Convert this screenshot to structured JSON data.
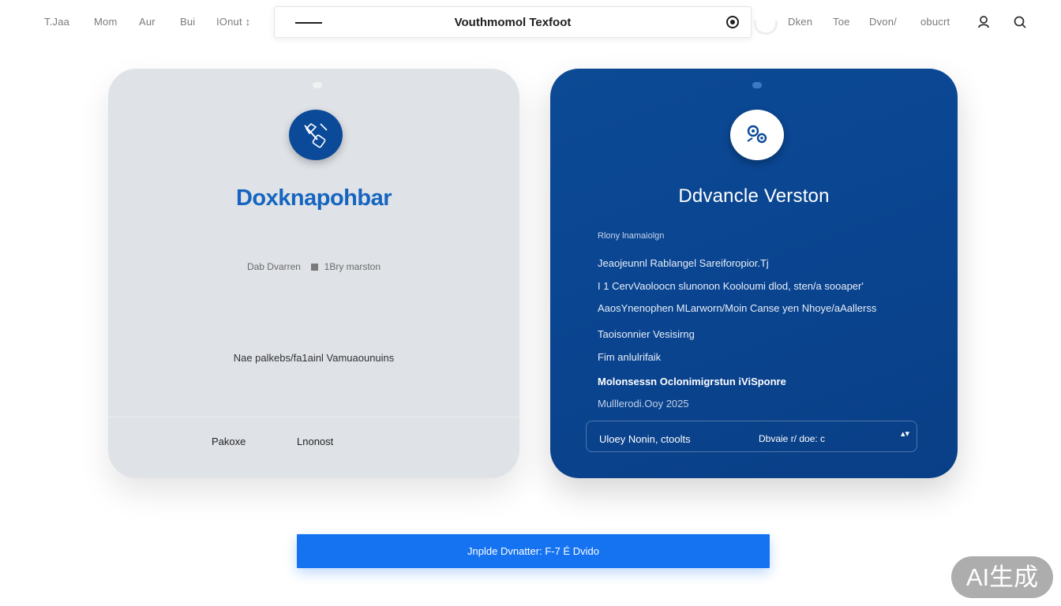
{
  "nav": {
    "left_links": [
      "T.Jaa",
      "Mom",
      "Aur",
      "Bui",
      "IOnut ↕"
    ],
    "right_links": [
      "Dken",
      "Toe",
      "Dvon/",
      "obucrt"
    ],
    "user_icon": "user-icon",
    "search_icon": "search-icon"
  },
  "search": {
    "title": "Vouthmomol Texfoot",
    "clear_icon": "clear-circle-icon"
  },
  "left_card": {
    "badge_icon": "tools-icon",
    "title": "Doxknapohbar",
    "meta_a": "Dab Dvarren",
    "meta_b": "1Bry marston",
    "note": "Nae palkebs/fa1ainl Vamuaounuins",
    "button_a": "Pakoxe",
    "button_b": "Lnonost",
    "background": "#dfe2e7",
    "title_color": "#1565c0"
  },
  "right_card": {
    "badge_icon": "gears-icon",
    "title": "Ddvancle Verston",
    "subtitle": "Rlony lnamaiolgn",
    "features": [
      "Jeaojeunnl Rablangel Sareiforopior.Tj",
      "I 1 CervVaoloocn slunonon Kooloumi dlod, sten/a sooaper'",
      "AaosYnenophen MLarworn/Moin Canse yen Nhoye/aAallerss",
      "Taoisonnier Vesisirng",
      "Fim anlulrifaik",
      "Molonsessn Oclonimigrstun iViSponre",
      "Mulllerodi.Ooy 2025"
    ],
    "plan_label": "Uloey Nonin, ctoolts",
    "plan_value": "Dbvaie r/ doe: c",
    "plan_caret": "▴▾",
    "background": "#0a4591"
  },
  "cta": {
    "label": "Jnplde Dvnatter: F-7 É Dvido",
    "color": "#1573f2"
  },
  "watermark": {
    "text": "AI生成"
  }
}
